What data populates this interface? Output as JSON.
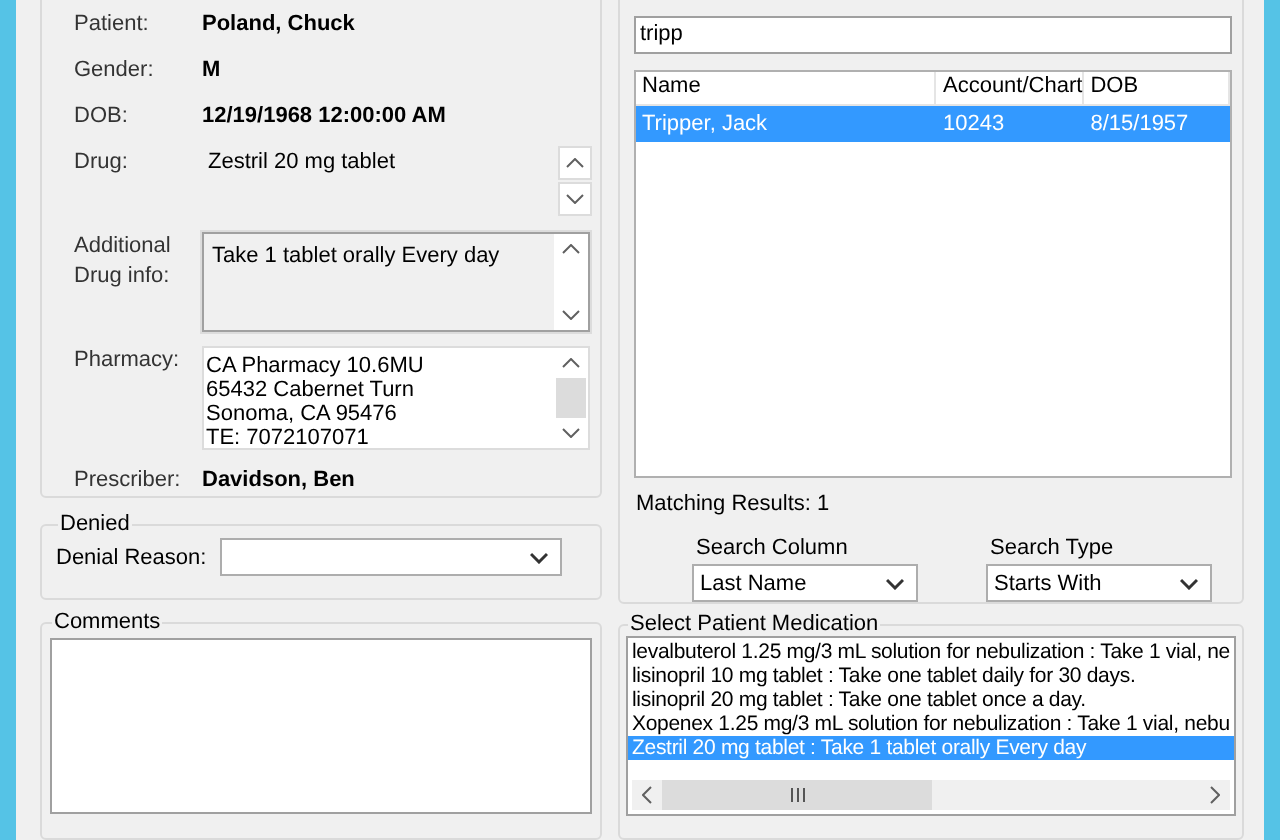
{
  "patient_panel": {
    "fields": [
      {
        "label": "Patient:",
        "value": "Poland, Chuck",
        "kind": "bold"
      },
      {
        "label": "Gender:",
        "value": "M",
        "kind": "bold"
      },
      {
        "label": "DOB:",
        "value": "12/19/1968 12:00:00 AM",
        "kind": "bold"
      },
      {
        "label": "Drug:",
        "value": "Zestril 20 mg tablet",
        "kind": "spin"
      },
      {
        "label": "Additional Drug info:",
        "lines": [
          "Take 1 tablet orally Every day"
        ],
        "kind": "memo"
      },
      {
        "label": "Pharmacy:",
        "lines": [
          "CA Pharmacy 10.6MU",
          "65432 Cabernet Turn",
          "Sonoma, CA 95476",
          "TE: 7072107071"
        ],
        "kind": "memo_thumb"
      },
      {
        "label": "Prescriber:",
        "value": "Davidson, Ben",
        "kind": "bold"
      }
    ]
  },
  "denied": {
    "title": "Denied",
    "label": "Denial Reason:"
  },
  "comments": {
    "title": "Comments"
  },
  "patient_search": {
    "search": {
      "value": "tripp"
    },
    "table": {
      "columns": [
        "Name",
        "Account/Chart",
        "DOB"
      ],
      "rows": [
        {
          "cells": [
            "Tripper, Jack",
            "10243",
            "8/15/1957"
          ],
          "selected": true
        }
      ]
    },
    "matching": "Matching Results: 1",
    "search_column": {
      "label": "Search Column",
      "value": "Last Name"
    },
    "search_type": {
      "label": "Search Type",
      "value": "Starts With"
    }
  },
  "medication": {
    "title": "Select Patient Medication",
    "items": [
      {
        "text": "levalbuterol 1.25 mg/3 mL solution for nebulization : Take 1 vial, ne",
        "selected": false
      },
      {
        "text": "lisinopril 10 mg tablet : Take one tablet daily for 30 days.",
        "selected": false
      },
      {
        "text": "lisinopril 20 mg tablet : Take one tablet once a day.",
        "selected": false
      },
      {
        "text": "Xopenex 1.25 mg/3 mL solution for nebulization : Take 1 vial, nebu",
        "selected": false
      },
      {
        "text": "Zestril 20 mg tablet : Take 1 tablet orally Every day",
        "selected": true
      }
    ]
  }
}
